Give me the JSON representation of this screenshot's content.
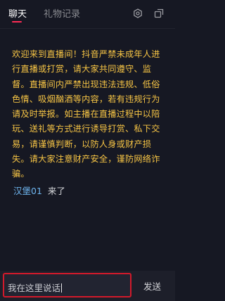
{
  "header": {
    "tabs": [
      {
        "label": "聊天",
        "active": true
      },
      {
        "label": "礼物记录",
        "active": false
      }
    ],
    "icons": [
      "settings-icon",
      "popout-icon"
    ]
  },
  "notice": {
    "text": "欢迎来到直播间！抖音严禁未成年人进行直播或打赏，请大家共同遵守、监督。直播间内严禁出现违法违规、低俗色情、吸烟酗酒等内容，若有违规行为请及时举报。如主播在直播过程中以陪玩、送礼等方式进行诱导打赏、私下交易，请谨慎判断，以防人身或财产损失。请大家注意财产安全，谨防网络诈骗。",
    "color": "#f7c545"
  },
  "messages": [
    {
      "user": "汉堡01",
      "text": "来了",
      "user_color": "#6fb6f0"
    }
  ],
  "composer": {
    "input_value": "我在这里说话",
    "send_label": "发送",
    "highlight_color": "#d21a2b"
  }
}
